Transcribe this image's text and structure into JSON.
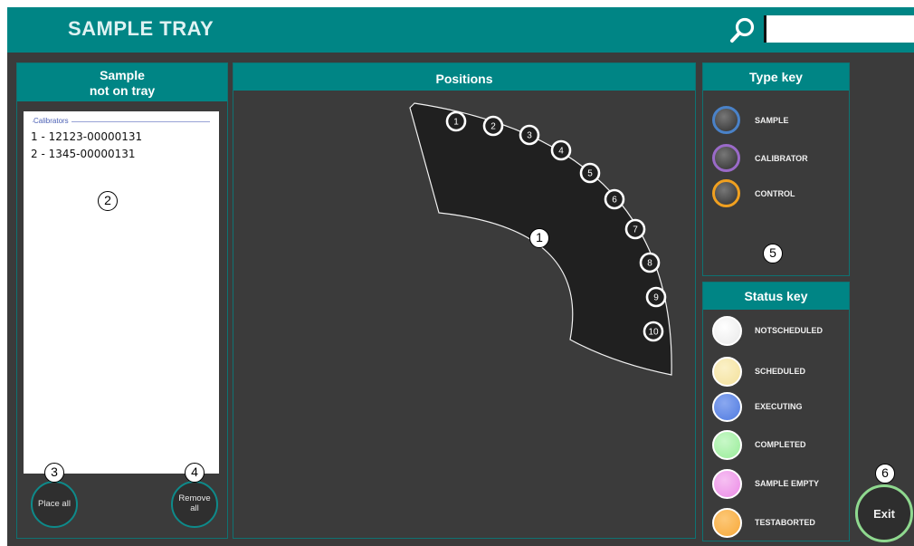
{
  "app": {
    "title": "SAMPLE TRAY"
  },
  "search": {
    "placeholder": "",
    "value": ""
  },
  "left_panel": {
    "title_line1": "Sample",
    "title_line2": "not on tray",
    "group": "Calibrators",
    "items": [
      "1 - 12123-00000131",
      "2 - 1345-00000131"
    ],
    "place_all": "Place all",
    "remove_all_line1": "Remove",
    "remove_all_line2": "all"
  },
  "positions_panel": {
    "title": "Positions",
    "positions": [
      "1",
      "2",
      "3",
      "4",
      "5",
      "6",
      "7",
      "8",
      "9",
      "10"
    ]
  },
  "type_key": {
    "title": "Type key",
    "items": [
      {
        "label": "SAMPLE",
        "ring_color": "#4a82c8",
        "icon": "sample-type-icon"
      },
      {
        "label": "CALIBRATOR",
        "ring_color": "#9a6ac8",
        "icon": "calibrator-type-icon"
      },
      {
        "label": "CONTROL",
        "ring_color": "#f0a020",
        "icon": "control-type-icon"
      }
    ]
  },
  "status_key": {
    "title": "Status key",
    "items": [
      {
        "label": "NOTSCHEDULED",
        "color": "#e8e8e8",
        "icon": "not-scheduled-status-icon"
      },
      {
        "label": "SCHEDULED",
        "color": "#f3e09a",
        "icon": "scheduled-status-icon"
      },
      {
        "label": "EXECUTING",
        "color": "#4f7ae0",
        "icon": "executing-status-icon"
      },
      {
        "label": "COMPLETED",
        "color": "#98ec98",
        "icon": "completed-status-icon"
      },
      {
        "label": "SAMPLE EMPTY",
        "color": "#ec8ae6",
        "icon": "sample-empty-status-icon"
      },
      {
        "label": "TESTABORTED",
        "color": "#f8a838",
        "icon": "test-aborted-status-icon"
      }
    ]
  },
  "exit": {
    "label": "Exit"
  },
  "callouts": [
    "1",
    "2",
    "3",
    "4",
    "5",
    "6"
  ]
}
